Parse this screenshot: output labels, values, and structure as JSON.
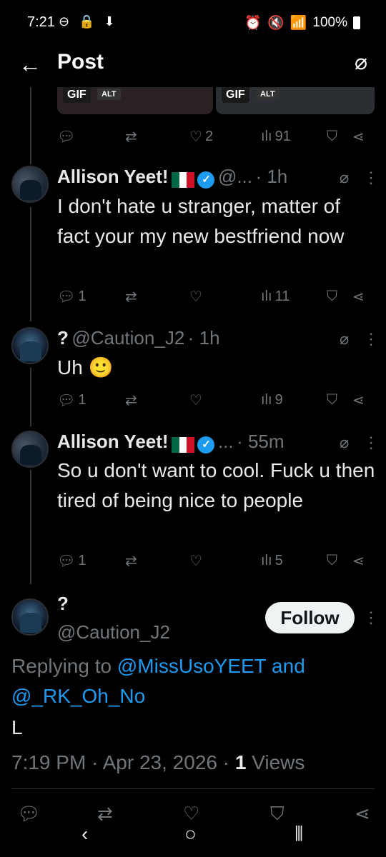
{
  "status": {
    "time": "7:21",
    "left_icons": "⊖ 🔒 ⬇",
    "battery": "100%"
  },
  "header": {
    "title": "Post",
    "back_icon": "←",
    "grok_icon": "⌀"
  },
  "media": {
    "gif1": "GIF",
    "alt1": "ALT",
    "gif2": "GIF",
    "alt2": "ALT"
  },
  "top_actions": {
    "likes": "2",
    "views": "91"
  },
  "replies": [
    {
      "name": "Allison Yeet!",
      "handle": "@...",
      "time": "· 1h",
      "text": "I don't hate u stranger, matter of fact your my new bestfriend now",
      "reply_count": "1",
      "views": "11"
    },
    {
      "name": "?",
      "handle": "@Caution_J2",
      "time": "· 1h",
      "text": "Uh 🙂",
      "reply_count": "1",
      "views": "9"
    },
    {
      "name": "Allison Yeet!",
      "handle": "...",
      "time": "· 55m",
      "text": "So u don't want to cool. Fuck u then tired of being nice to people",
      "reply_count": "1",
      "views": "5"
    }
  ],
  "main_post": {
    "name": "?",
    "handle": "@Caution_J2",
    "follow_label": "Follow",
    "replying_prefix": "Replying to ",
    "reply_to_1": "@MissUsoYEET",
    "reply_and": " and",
    "reply_to_2": "@_RK_Oh_No",
    "text": "L",
    "timestamp": "7:19 PM · Apr 23, 2026 · ",
    "views_count": "1",
    "views_label": " Views"
  },
  "colors": {
    "accent": "#1d9bf0",
    "muted": "#71767b",
    "bg": "#000000"
  }
}
